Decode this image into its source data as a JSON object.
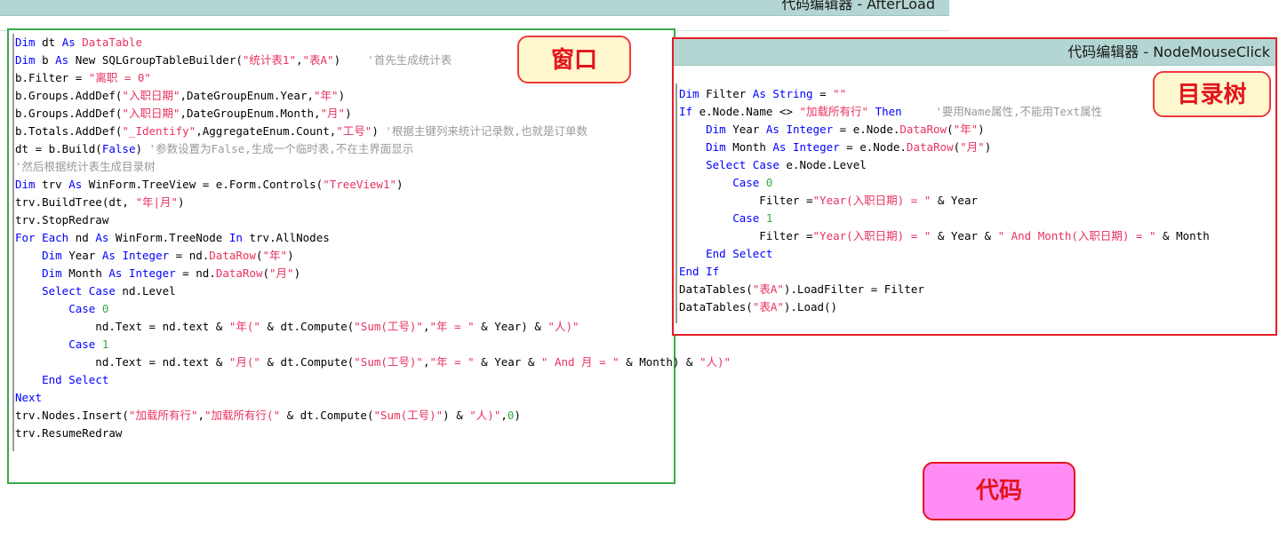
{
  "afterload_editor": {
    "title": "代码编辑器 - AfterLoad",
    "lines": [
      [
        {
          "c": "kw",
          "t": "Dim"
        },
        {
          "t": " dt "
        },
        {
          "c": "kw",
          "t": "As"
        },
        {
          "t": " "
        },
        {
          "c": "ty",
          "t": "DataTable"
        }
      ],
      [
        {
          "c": "kw",
          "t": "Dim"
        },
        {
          "t": " b "
        },
        {
          "c": "kw",
          "t": "As"
        },
        {
          "t": " New SQLGroupTableBuilder("
        },
        {
          "c": "st",
          "t": "\"统计表1\""
        },
        {
          "t": ","
        },
        {
          "c": "st",
          "t": "\"表A\""
        },
        {
          "t": ")    "
        },
        {
          "c": "cm",
          "t": "'首先生成统计表"
        }
      ],
      [
        {
          "t": "b.Filter = "
        },
        {
          "c": "st",
          "t": "\"离职 = 0\""
        }
      ],
      [
        {
          "t": "b.Groups.AddDef("
        },
        {
          "c": "st",
          "t": "\"入职日期\""
        },
        {
          "t": ",DateGroupEnum.Year,"
        },
        {
          "c": "st",
          "t": "\"年\""
        },
        {
          "t": ")"
        }
      ],
      [
        {
          "t": "b.Groups.AddDef("
        },
        {
          "c": "st",
          "t": "\"入职日期\""
        },
        {
          "t": ",DateGroupEnum.Month,"
        },
        {
          "c": "st",
          "t": "\"月\""
        },
        {
          "t": ")"
        }
      ],
      [
        {
          "t": "b.Totals.AddDef("
        },
        {
          "c": "st",
          "t": "\"_Identify\""
        },
        {
          "t": ",AggregateEnum.Count,"
        },
        {
          "c": "st",
          "t": "\"工号\""
        },
        {
          "t": ") "
        },
        {
          "c": "cm",
          "t": "'根据主键列来统计记录数,也就是订单数"
        }
      ],
      [
        {
          "t": "dt = b.Build("
        },
        {
          "c": "kw",
          "t": "False"
        },
        {
          "t": ") "
        },
        {
          "c": "cm",
          "t": "'参数设置为False,生成一个临时表,不在主界面显示"
        }
      ],
      [
        {
          "c": "cm",
          "t": "'然后根据统计表生成目录树"
        }
      ],
      [
        {
          "c": "kw",
          "t": "Dim"
        },
        {
          "t": " trv "
        },
        {
          "c": "kw",
          "t": "As"
        },
        {
          "t": " WinForm.TreeView = e.Form.Controls("
        },
        {
          "c": "st",
          "t": "\"TreeView1\""
        },
        {
          "t": ")"
        }
      ],
      [
        {
          "t": "trv.BuildTree(dt, "
        },
        {
          "c": "st",
          "t": "\"年|月\""
        },
        {
          "t": ")"
        }
      ],
      [
        {
          "t": "trv.StopRedraw"
        }
      ],
      [
        {
          "c": "kw",
          "t": "For Each"
        },
        {
          "t": " nd "
        },
        {
          "c": "kw",
          "t": "As"
        },
        {
          "t": " WinForm.TreeNode "
        },
        {
          "c": "kw",
          "t": "In"
        },
        {
          "t": " trv.AllNodes"
        }
      ],
      [
        {
          "t": "    "
        },
        {
          "c": "kw",
          "t": "Dim"
        },
        {
          "t": " Year "
        },
        {
          "c": "kw",
          "t": "As"
        },
        {
          "t": " "
        },
        {
          "c": "kw",
          "t": "Integer"
        },
        {
          "t": " = nd."
        },
        {
          "c": "ty",
          "t": "DataRow"
        },
        {
          "t": "("
        },
        {
          "c": "st",
          "t": "\"年\""
        },
        {
          "t": ")"
        }
      ],
      [
        {
          "t": "    "
        },
        {
          "c": "kw",
          "t": "Dim"
        },
        {
          "t": " Month "
        },
        {
          "c": "kw",
          "t": "As"
        },
        {
          "t": " "
        },
        {
          "c": "kw",
          "t": "Integer"
        },
        {
          "t": " = nd."
        },
        {
          "c": "ty",
          "t": "DataRow"
        },
        {
          "t": "("
        },
        {
          "c": "st",
          "t": "\"月\""
        },
        {
          "t": ")"
        }
      ],
      [
        {
          "t": "    "
        },
        {
          "c": "kw",
          "t": "Select Case"
        },
        {
          "t": " nd.Level"
        }
      ],
      [
        {
          "t": "        "
        },
        {
          "c": "kw",
          "t": "Case"
        },
        {
          "t": " "
        },
        {
          "c": "nm",
          "t": "0"
        }
      ],
      [
        {
          "t": "            nd.Text = nd.text & "
        },
        {
          "c": "st",
          "t": "\"年(\""
        },
        {
          "t": " & dt.Compute("
        },
        {
          "c": "st",
          "t": "\"Sum(工号)\""
        },
        {
          "t": ","
        },
        {
          "c": "st",
          "t": "\"年 = \""
        },
        {
          "t": " & Year) & "
        },
        {
          "c": "st",
          "t": "\"人)\""
        }
      ],
      [
        {
          "t": "        "
        },
        {
          "c": "kw",
          "t": "Case"
        },
        {
          "t": " "
        },
        {
          "c": "nm",
          "t": "1"
        }
      ],
      [
        {
          "t": "            nd.Text = nd.text & "
        },
        {
          "c": "st",
          "t": "\"月(\""
        },
        {
          "t": " & dt.Compute("
        },
        {
          "c": "st",
          "t": "\"Sum(工号)\""
        },
        {
          "t": ","
        },
        {
          "c": "st",
          "t": "\"年 = \""
        },
        {
          "t": " & Year & "
        },
        {
          "c": "st",
          "t": "\" And 月 = \""
        },
        {
          "t": " & Month) & "
        },
        {
          "c": "st",
          "t": "\"人)\""
        }
      ],
      [
        {
          "t": "    "
        },
        {
          "c": "kw",
          "t": "End Select"
        }
      ],
      [
        {
          "c": "kw",
          "t": "Next"
        }
      ],
      [
        {
          "t": "trv.Nodes.Insert("
        },
        {
          "c": "st",
          "t": "\"加载所有行\""
        },
        {
          "t": ","
        },
        {
          "c": "st",
          "t": "\"加载所有行(\""
        },
        {
          "t": " & dt.Compute("
        },
        {
          "c": "st",
          "t": "\"Sum(工号)\""
        },
        {
          "t": ") & "
        },
        {
          "c": "st",
          "t": "\"人)\""
        },
        {
          "t": ","
        },
        {
          "c": "nm",
          "t": "0"
        },
        {
          "t": ")"
        }
      ],
      [
        {
          "t": "trv.ResumeRedraw"
        }
      ]
    ]
  },
  "nodemouseclick_editor": {
    "title": "代码编辑器 - NodeMouseClick",
    "lines": [
      [
        {
          "c": "kw",
          "t": "Dim"
        },
        {
          "t": " Filter "
        },
        {
          "c": "kw",
          "t": "As"
        },
        {
          "t": " "
        },
        {
          "c": "kw",
          "t": "String"
        },
        {
          "t": " = "
        },
        {
          "c": "st",
          "t": "\"\""
        }
      ],
      [
        {
          "c": "kw",
          "t": "If"
        },
        {
          "t": " e.Node.Name <> "
        },
        {
          "c": "st",
          "t": "\"加载所有行\""
        },
        {
          "t": " "
        },
        {
          "c": "kw",
          "t": "Then"
        },
        {
          "t": "     "
        },
        {
          "c": "cm",
          "t": "'要用Name属性,不能用Text属性"
        }
      ],
      [
        {
          "t": "    "
        },
        {
          "c": "kw",
          "t": "Dim"
        },
        {
          "t": " Year "
        },
        {
          "c": "kw",
          "t": "As"
        },
        {
          "t": " "
        },
        {
          "c": "kw",
          "t": "Integer"
        },
        {
          "t": " = e.Node."
        },
        {
          "c": "ty",
          "t": "DataRow"
        },
        {
          "t": "("
        },
        {
          "c": "st",
          "t": "\"年\""
        },
        {
          "t": ")"
        }
      ],
      [
        {
          "t": "    "
        },
        {
          "c": "kw",
          "t": "Dim"
        },
        {
          "t": " Month "
        },
        {
          "c": "kw",
          "t": "As"
        },
        {
          "t": " "
        },
        {
          "c": "kw",
          "t": "Integer"
        },
        {
          "t": " = e.Node."
        },
        {
          "c": "ty",
          "t": "DataRow"
        },
        {
          "t": "("
        },
        {
          "c": "st",
          "t": "\"月\""
        },
        {
          "t": ")"
        }
      ],
      [
        {
          "t": "    "
        },
        {
          "c": "kw",
          "t": "Select Case"
        },
        {
          "t": " e.Node.Level"
        }
      ],
      [
        {
          "t": "        "
        },
        {
          "c": "kw",
          "t": "Case"
        },
        {
          "t": " "
        },
        {
          "c": "nm",
          "t": "0"
        }
      ],
      [
        {
          "t": "            Filter ="
        },
        {
          "c": "st",
          "t": "\"Year(入职日期) = \""
        },
        {
          "t": " & Year"
        }
      ],
      [
        {
          "t": "        "
        },
        {
          "c": "kw",
          "t": "Case"
        },
        {
          "t": " "
        },
        {
          "c": "nm",
          "t": "1"
        }
      ],
      [
        {
          "t": "            Filter ="
        },
        {
          "c": "st",
          "t": "\"Year(入职日期) = \""
        },
        {
          "t": " & Year & "
        },
        {
          "c": "st",
          "t": "\" And Month(入职日期) = \""
        },
        {
          "t": " & Month"
        }
      ],
      [
        {
          "t": "    "
        },
        {
          "c": "kw",
          "t": "End Select"
        }
      ],
      [
        {
          "c": "kw",
          "t": "End If"
        }
      ],
      [
        {
          "t": "DataTables("
        },
        {
          "c": "st",
          "t": "\"表A\""
        },
        {
          "t": ").LoadFilter = Filter"
        }
      ],
      [
        {
          "t": "DataTables("
        },
        {
          "c": "st",
          "t": "\"表A\""
        },
        {
          "t": ").Load()"
        }
      ]
    ]
  },
  "callouts": {
    "window": "窗口",
    "tree": "目录树",
    "code": "代码"
  }
}
